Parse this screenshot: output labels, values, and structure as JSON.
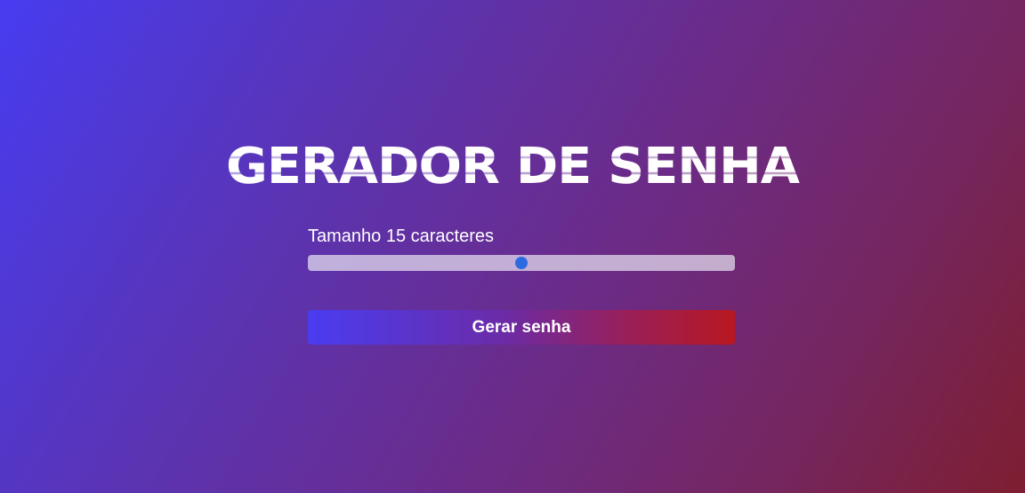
{
  "title": "GERADOR DE SENHA",
  "length": {
    "label_text": "Tamanho 15 caracteres",
    "value": 15,
    "slider_fraction": 0.5
  },
  "generate_button": {
    "label": "Gerar senha"
  },
  "colors": {
    "slider_thumb": "#2d6ae0",
    "button_gradient_start": "#4a3cf0",
    "button_gradient_end": "#b81820"
  }
}
